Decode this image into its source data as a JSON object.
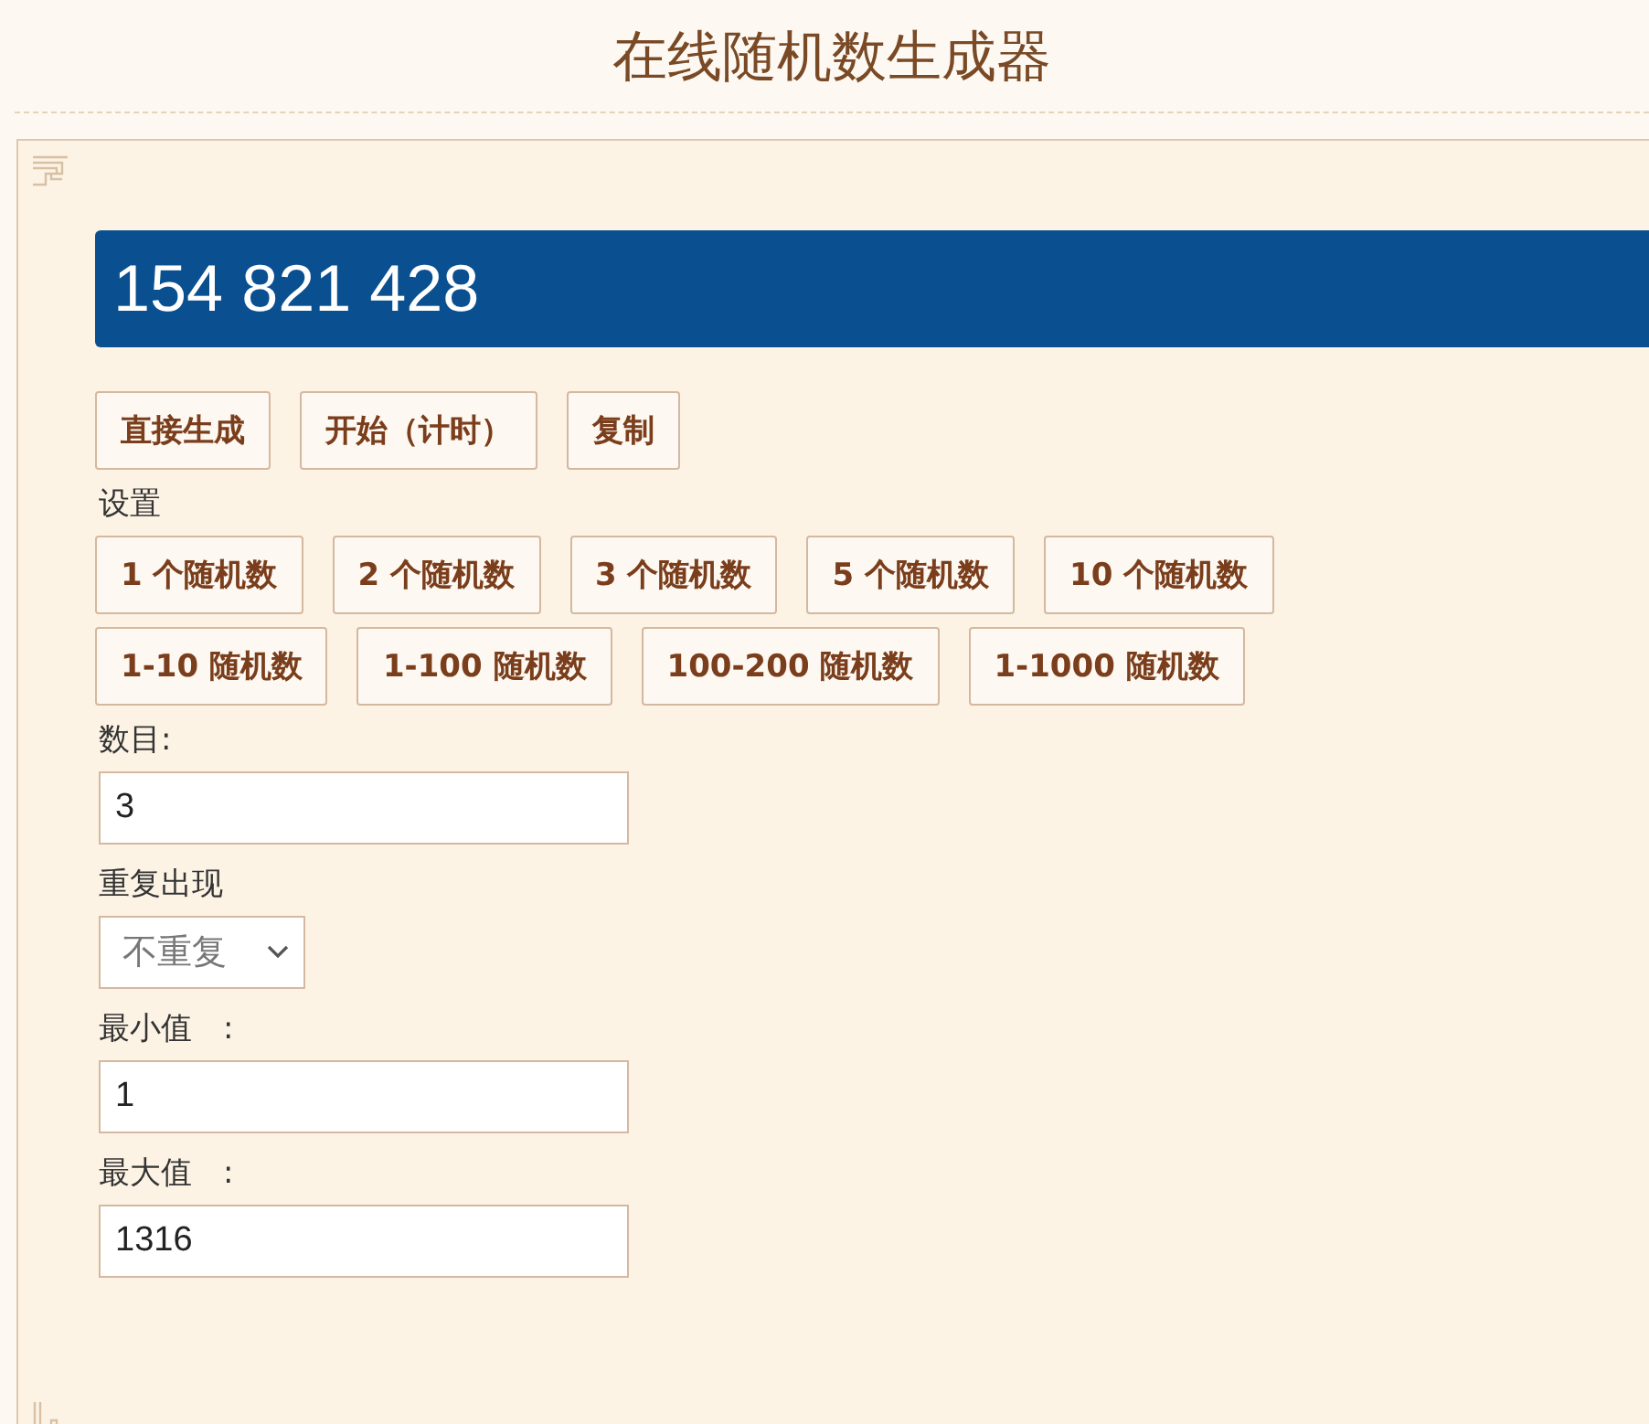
{
  "title": "在线随机数生成器",
  "result": "154 821 428",
  "action_buttons": [
    "直接生成",
    "开始（计时）",
    "复制"
  ],
  "settings_label": "设置",
  "preset_rows": [
    [
      "1 个随机数",
      "2 个随机数",
      "3 个随机数",
      "5 个随机数",
      "10 个随机数"
    ],
    [
      "1-10 随机数",
      "1-100 随机数",
      "100-200 随机数",
      "1-1000 随机数"
    ]
  ],
  "fields": [
    {
      "kind": "input",
      "label": "数目:",
      "value": "3"
    },
    {
      "kind": "select",
      "label": "重复出现",
      "value": "不重复"
    },
    {
      "kind": "input",
      "label": "最小值　:",
      "value": "1"
    },
    {
      "kind": "input",
      "label": "最大值　:",
      "value": "1316"
    }
  ]
}
